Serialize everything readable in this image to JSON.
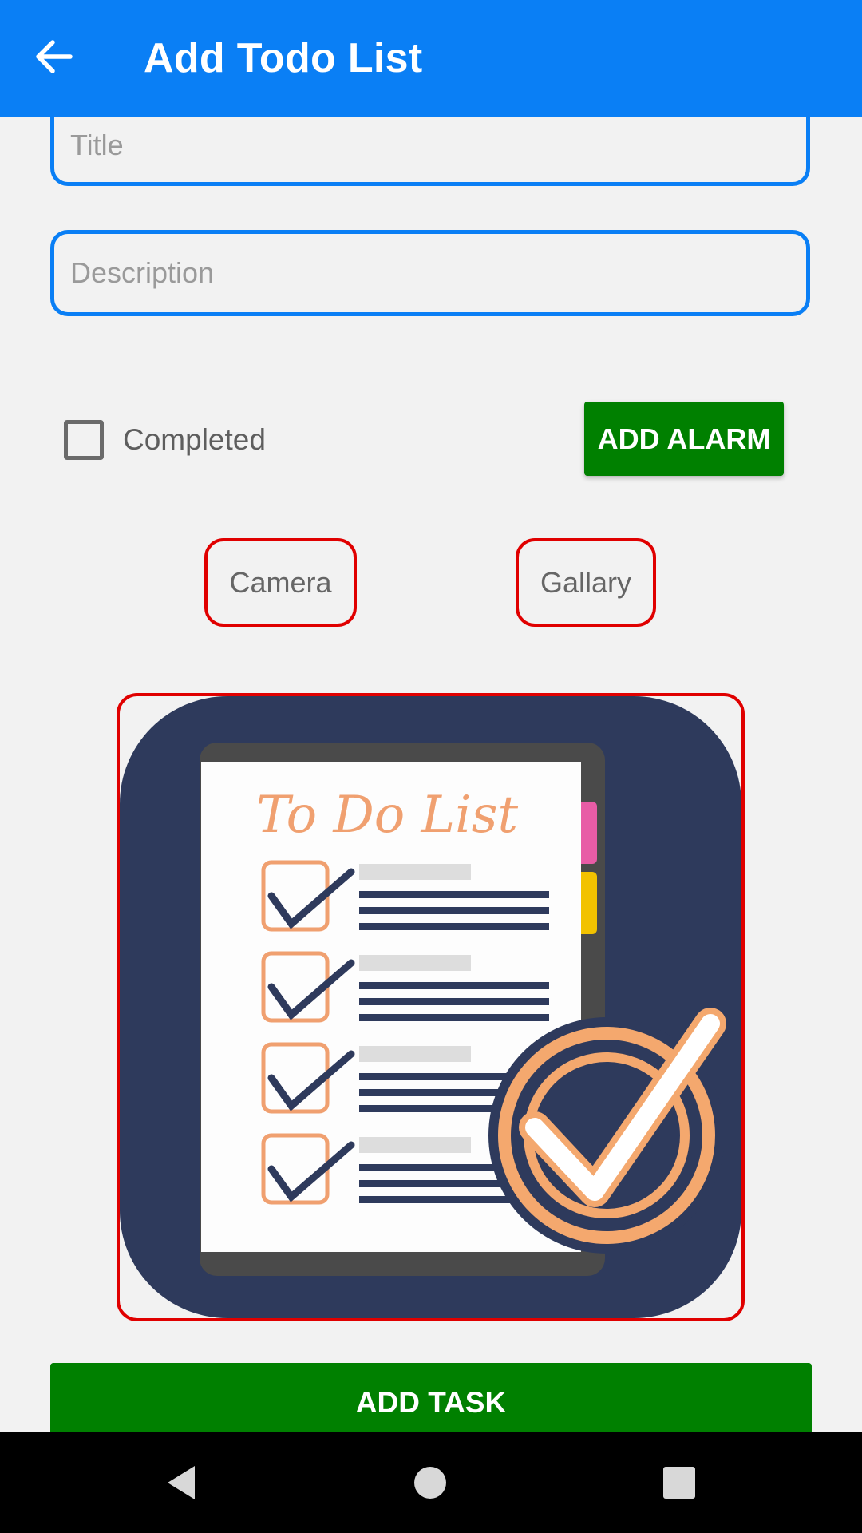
{
  "appbar": {
    "title": "Add Todo List",
    "back_icon": "arrow-left-icon",
    "color": "#0a7ff5"
  },
  "form": {
    "title_placeholder": "Title",
    "description_placeholder": "Description",
    "completed_label": "Completed",
    "completed_checked": false,
    "add_alarm_label": "ADD ALARM",
    "camera_label": "Camera",
    "gallery_label": "Gallary",
    "add_task_label": "ADD TASK"
  },
  "preview_image": {
    "heading": "To Do List",
    "icon": "todo-list-checkmark-image"
  },
  "colors": {
    "accent_blue": "#0a7ff5",
    "button_green": "#008000",
    "outline_red": "#e00000"
  },
  "navbar": {
    "back": "nav-back-icon",
    "home": "nav-home-icon",
    "recents": "nav-recents-icon"
  }
}
